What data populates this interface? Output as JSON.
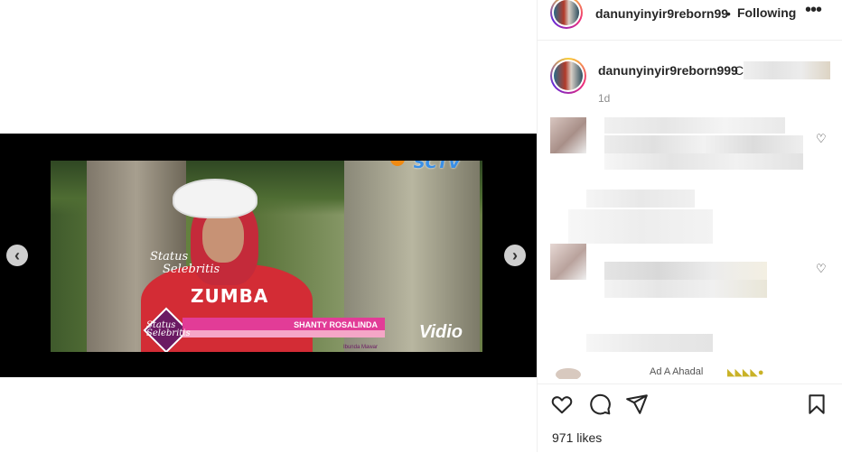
{
  "post": {
    "username": "danunyinyir9reborn99",
    "follow_separator": "•",
    "follow_label": "Following",
    "more_icon": "more-horizontal-icon",
    "caption_username": "danunyinyir9reborn999",
    "caption_visible": "C",
    "caption_time": "1d",
    "likes_text": "971 likes",
    "comment_tail_fragment": "Ad A Ahadal"
  },
  "media": {
    "channel_logo": "SCTV",
    "show_logo_line1": "Status",
    "show_logo_line2": "Selebritis",
    "lower_third_badge_line1": "Status",
    "lower_third_badge_line2": "Selebritis",
    "lower_third_name": "SHANTY ROSALINDA",
    "lower_third_subtitle": "Ibunda Mawar",
    "shirt_text": "ZUMBA",
    "watermark": "Vidio",
    "prev_icon": "chevron-left-icon",
    "next_icon": "chevron-right-icon"
  },
  "colors": {
    "accent_pink": "#e23c97",
    "lower_third_purple": "#6b1a63",
    "channel_blue": "#3a8fe6"
  }
}
